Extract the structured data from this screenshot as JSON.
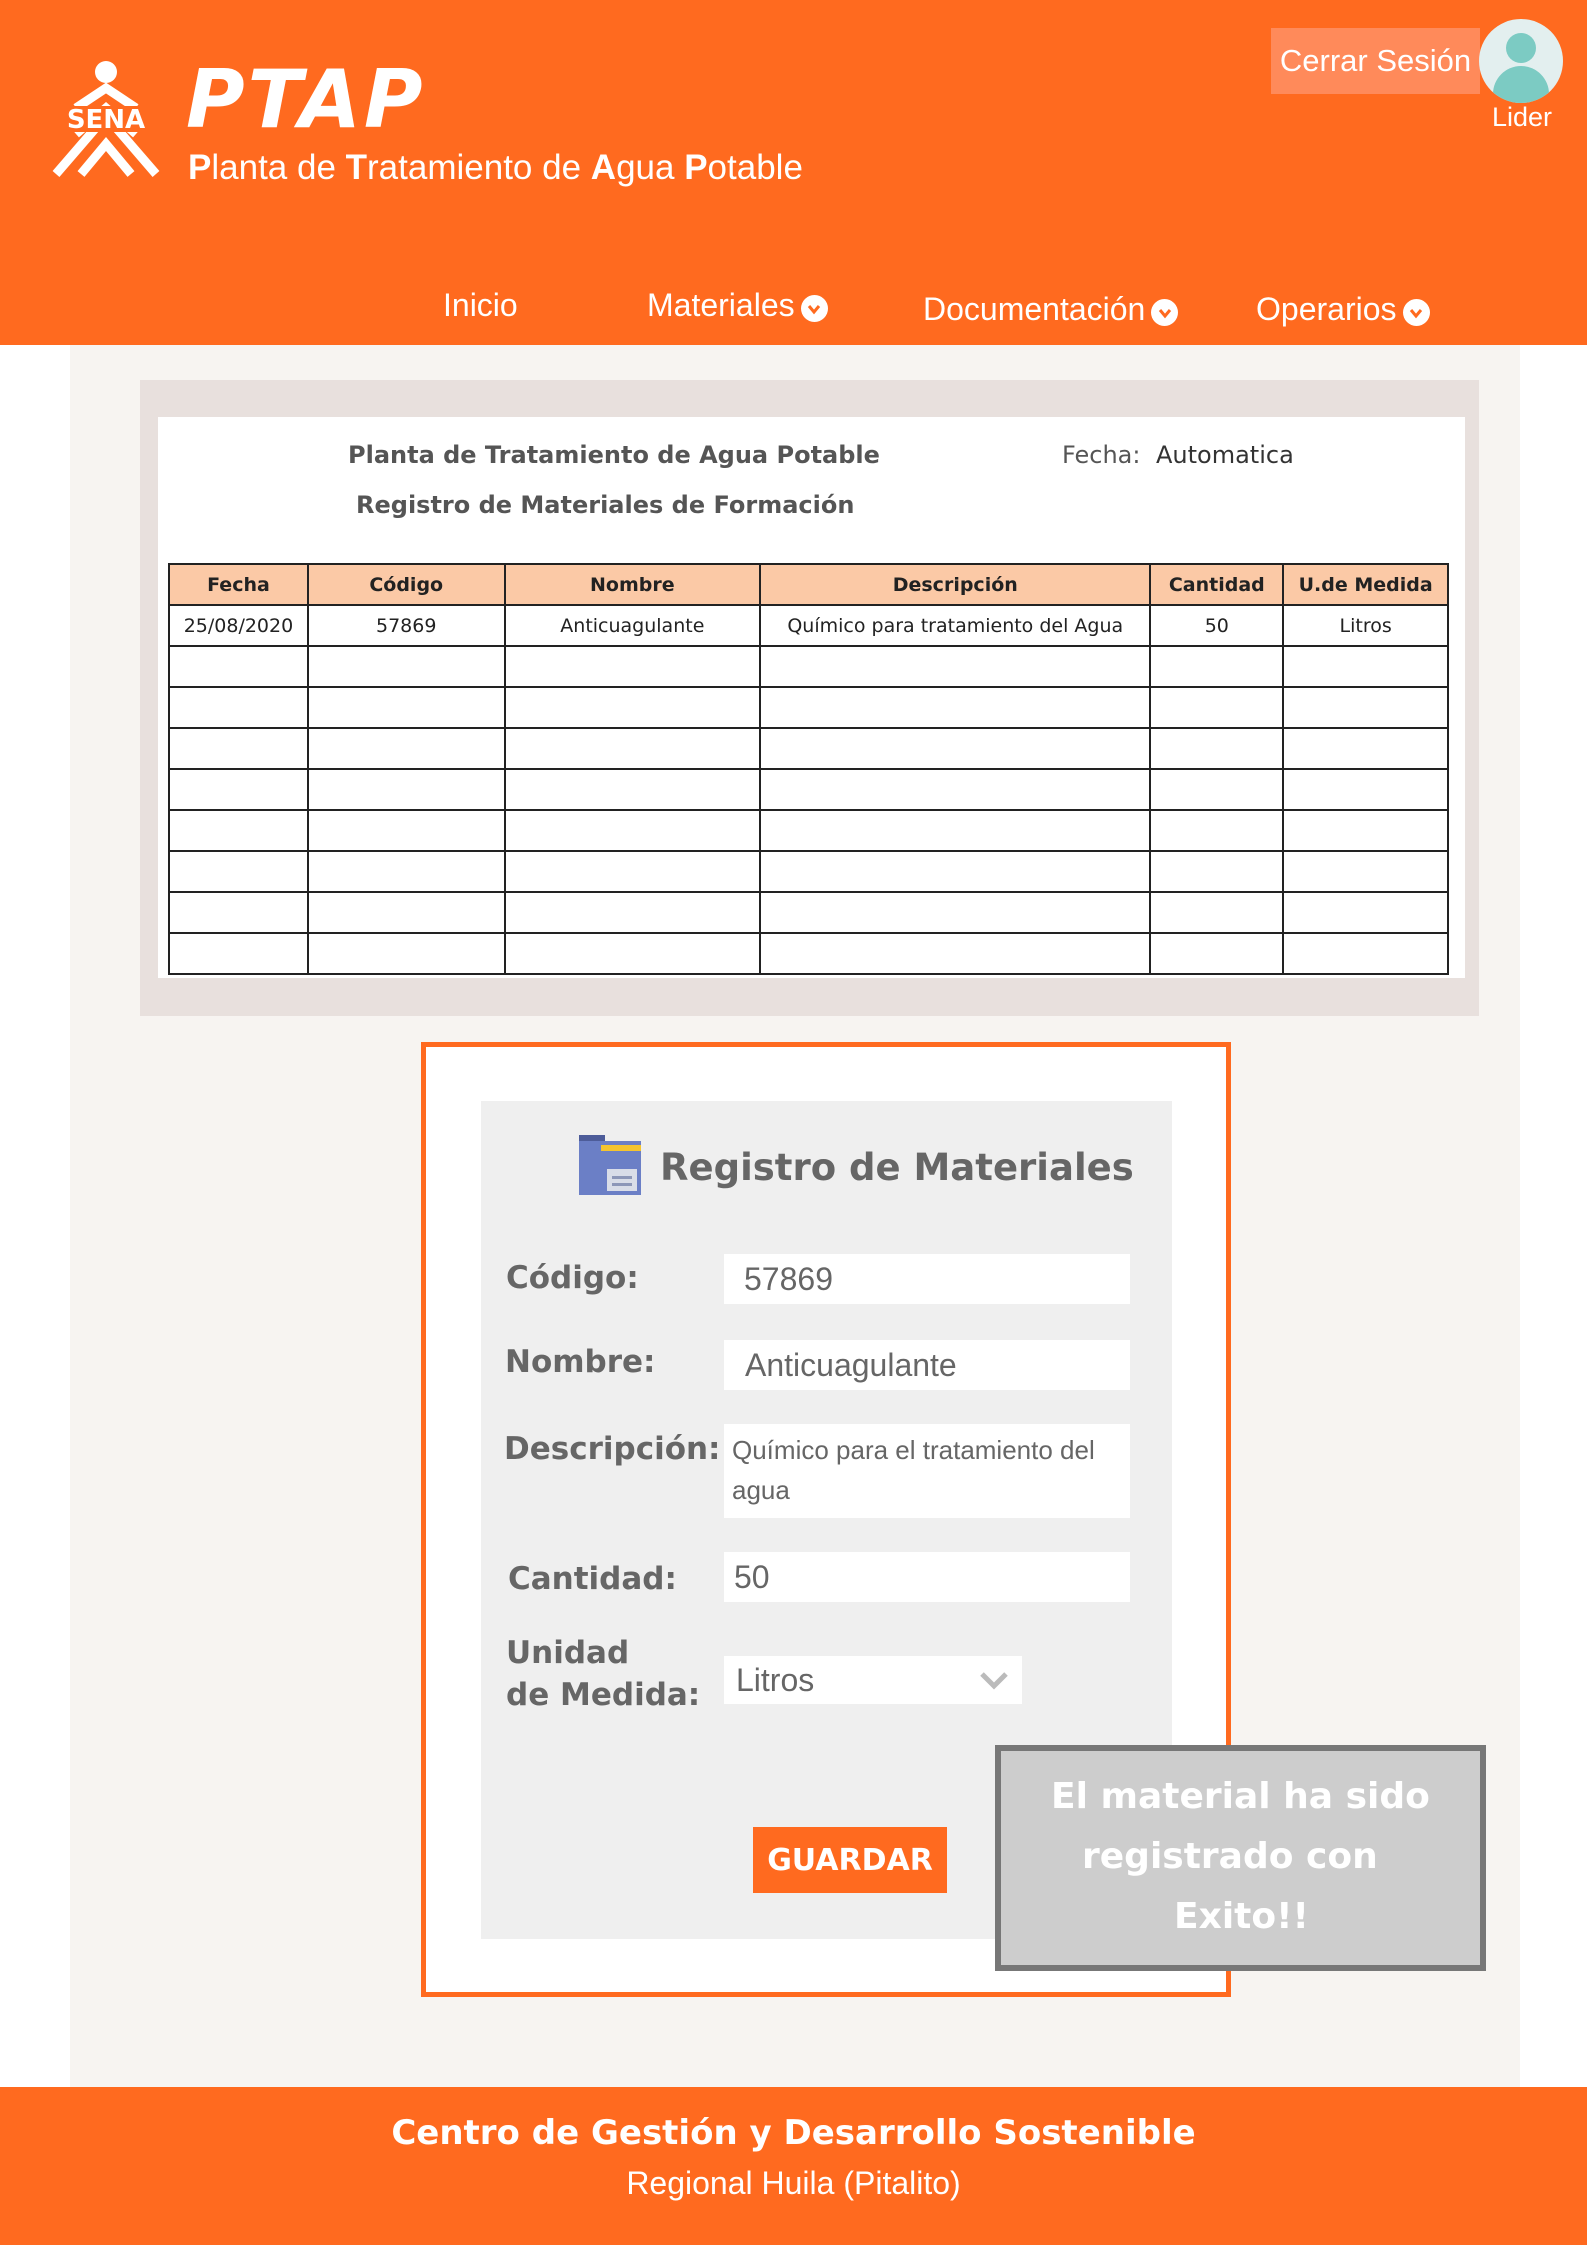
{
  "header": {
    "logo_text": "SENA",
    "brand": "PTAP",
    "subtitle_parts": [
      {
        "cap": "P",
        "rest": "lanta de "
      },
      {
        "cap": "T",
        "rest": "ratamiento de "
      },
      {
        "cap": "A",
        "rest": "gua "
      },
      {
        "cap": "P",
        "rest": "otable"
      }
    ],
    "logout_label": "Cerrar Sesión",
    "user_role": "Lider",
    "nav": [
      {
        "label": "Inicio",
        "dropdown": false
      },
      {
        "label": "Materiales",
        "dropdown": true
      },
      {
        "label": "Documentación",
        "dropdown": true
      },
      {
        "label": "Operarios",
        "dropdown": true
      }
    ]
  },
  "sheet": {
    "title_line1": "Planta de Tratamiento de Agua Potable",
    "title_line2": "Registro de Materiales de Formación",
    "date_label": "Fecha:",
    "date_value": "Automatica",
    "columns": [
      "Fecha",
      "Código",
      "Nombre",
      "Descripción",
      "Cantidad",
      "U.de Medida"
    ],
    "rows": [
      [
        "25/08/2020",
        "57869",
        "Anticuagulante",
        "Químico para tratamiento del Agua",
        "50",
        "Litros"
      ],
      [
        "",
        "",
        "",
        "",
        "",
        ""
      ],
      [
        "",
        "",
        "",
        "",
        "",
        ""
      ],
      [
        "",
        "",
        "",
        "",
        "",
        ""
      ],
      [
        "",
        "",
        "",
        "",
        "",
        ""
      ],
      [
        "",
        "",
        "",
        "",
        "",
        ""
      ],
      [
        "",
        "",
        "",
        "",
        "",
        ""
      ],
      [
        "",
        "",
        "",
        "",
        "",
        ""
      ],
      [
        "",
        "",
        "",
        "",
        "",
        ""
      ]
    ]
  },
  "form": {
    "icon": "folder-icon",
    "title": "Registro de Materiales",
    "codigo_label": "Código:",
    "codigo_value": "57869",
    "nombre_label": "Nombre:",
    "nombre_value": "Anticuagulante",
    "descripcion_label": "Descripción:",
    "descripcion_value": "Químico para el tratamiento del agua",
    "cantidad_label": "Cantidad:",
    "cantidad_value": "50",
    "unidad_label_line1": "Unidad",
    "unidad_label_line2": "de Medida:",
    "unidad_value": "Litros",
    "save_label": "GUARDAR"
  },
  "toast": {
    "line1": "El material ha sido",
    "line2": "registrado con",
    "line3": "Exito!!"
  },
  "footer": {
    "line1": "Centro de Gestión y Desarrollo Sostenible",
    "line2": "Regional Huila (Pitalito)"
  },
  "colors": {
    "accent": "#ff6a1f",
    "table_header": "#fbc9a6",
    "avatar": "#7ccbc3",
    "folder": "#6b7fc6"
  }
}
